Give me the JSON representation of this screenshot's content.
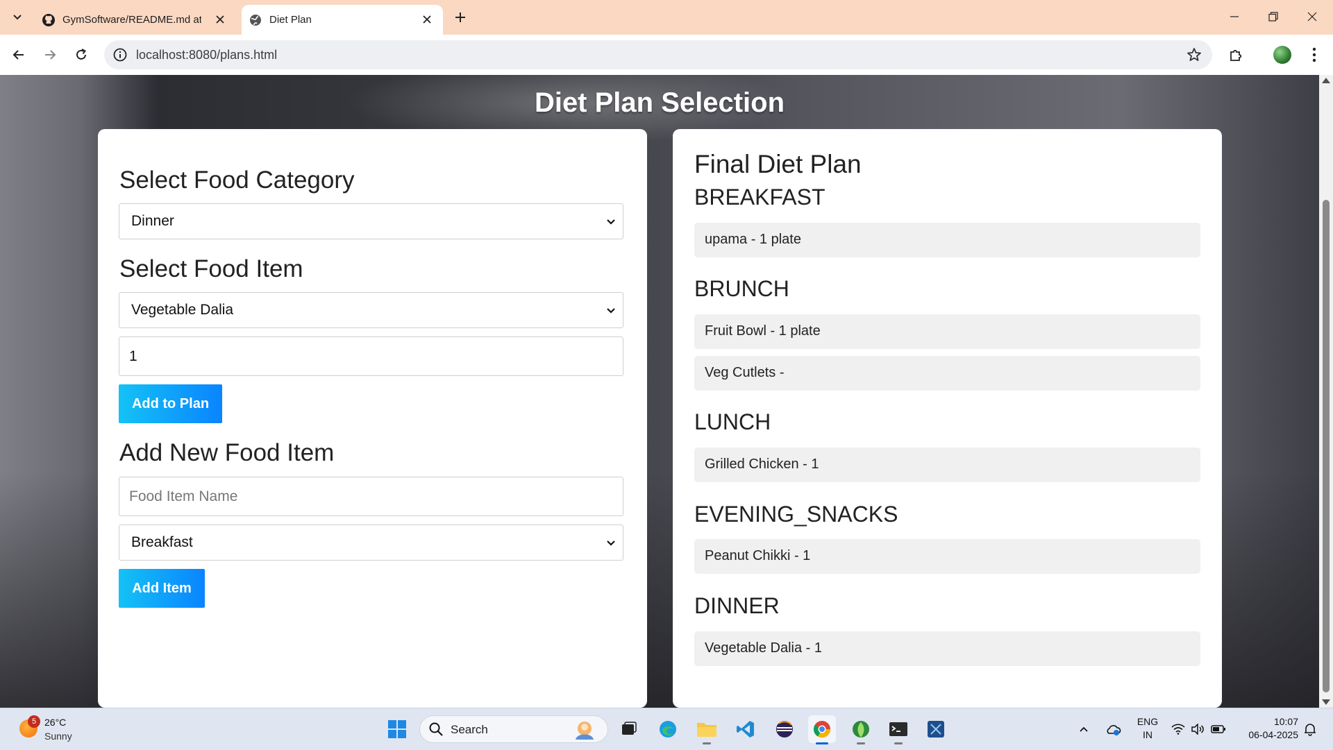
{
  "browser": {
    "tabs": [
      {
        "title": "GymSoftware/README.md at m",
        "active": false,
        "icon": "github-icon"
      },
      {
        "title": "Diet Plan",
        "active": true,
        "icon": "globe-icon"
      }
    ],
    "url": "localhost:8080/plans.html"
  },
  "page": {
    "title": "Diet Plan Selection",
    "left": {
      "category_heading": "Select Food Category",
      "category_value": "Dinner",
      "item_heading": "Select Food Item",
      "item_value": "Vegetable Dalia",
      "quantity_value": "1",
      "add_to_plan_label": "Add to Plan",
      "new_item_heading": "Add New Food Item",
      "new_item_placeholder": "Food Item Name",
      "new_item_category": "Breakfast",
      "add_item_label": "Add Item"
    },
    "right": {
      "title": "Final Diet Plan",
      "meals": [
        {
          "name": "BREAKFAST",
          "items": [
            "upama - 1 plate"
          ]
        },
        {
          "name": "BRUNCH",
          "items": [
            "Fruit Bowl - 1 plate",
            "Veg Cutlets -"
          ]
        },
        {
          "name": "LUNCH",
          "items": [
            "Grilled Chicken - 1"
          ]
        },
        {
          "name": "EVENING_SNACKS",
          "items": [
            "Peanut Chikki - 1"
          ]
        },
        {
          "name": "DINNER",
          "items": [
            "Vegetable Dalia - 1"
          ]
        }
      ]
    }
  },
  "taskbar": {
    "weather_badge": "5",
    "temperature": "26°C",
    "condition": "Sunny",
    "search_label": "Search",
    "lang_line1": "ENG",
    "lang_line2": "IN",
    "time": "10:07",
    "date": "06-04-2025"
  },
  "colors": {
    "tabbar_bg": "#fbd8c2",
    "button_gradient_start": "#14c2f5",
    "button_gradient_end": "#0a84ff"
  }
}
